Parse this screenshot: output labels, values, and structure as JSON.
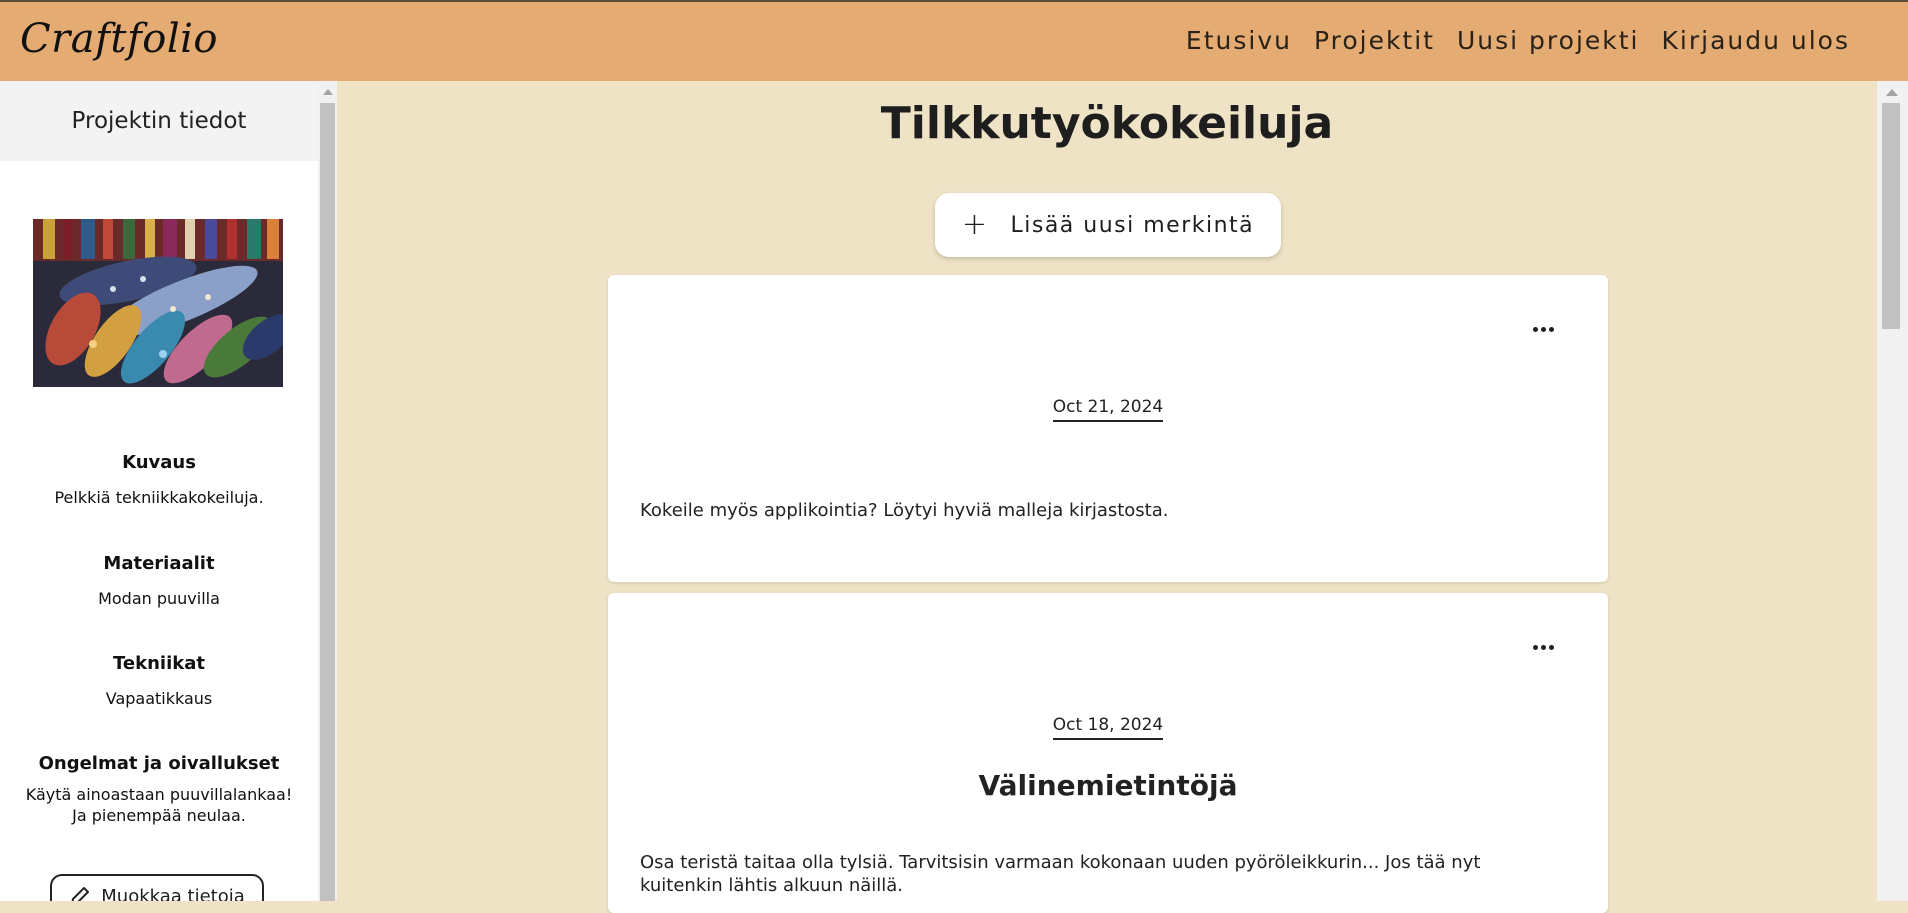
{
  "app": {
    "logo": "Craftfolio"
  },
  "nav": [
    "Etusivu",
    "Projektit",
    "Uusi projekti",
    "Kirjaudu ulos"
  ],
  "sidebar": {
    "heading": "Projektin tiedot",
    "sections": [
      {
        "title": "Kuvaus",
        "text": "Pelkkiä tekniikkakokeiluja."
      },
      {
        "title": "Materiaalit",
        "text": "Modan puuvilla"
      },
      {
        "title": "Tekniikat",
        "text": "Vapaatikkaus"
      },
      {
        "title": "Ongelmat ja oivallukset",
        "text": "Käytä ainoastaan puuvillalankaa! Ja pienempää neulaa."
      }
    ],
    "edit_button": "Muokkaa tietoja"
  },
  "main": {
    "title": "Tilkkutyökokeiluja",
    "add_button": "Lisää uusi merkintä",
    "entries": [
      {
        "date": "Oct 21, 2024",
        "heading": "",
        "text": "Kokeile myös applikointia? Löytyi hyviä malleja kirjastosta."
      },
      {
        "date": "Oct 18, 2024",
        "heading": "Välinemietintöjä",
        "text": "Osa teristä taitaa olla tylsiä. Tarvitsisin varmaan kokonaan uuden pyöröleikkurin... Jos tää nyt kuitenkin lähtis alkuun näillä."
      }
    ]
  }
}
